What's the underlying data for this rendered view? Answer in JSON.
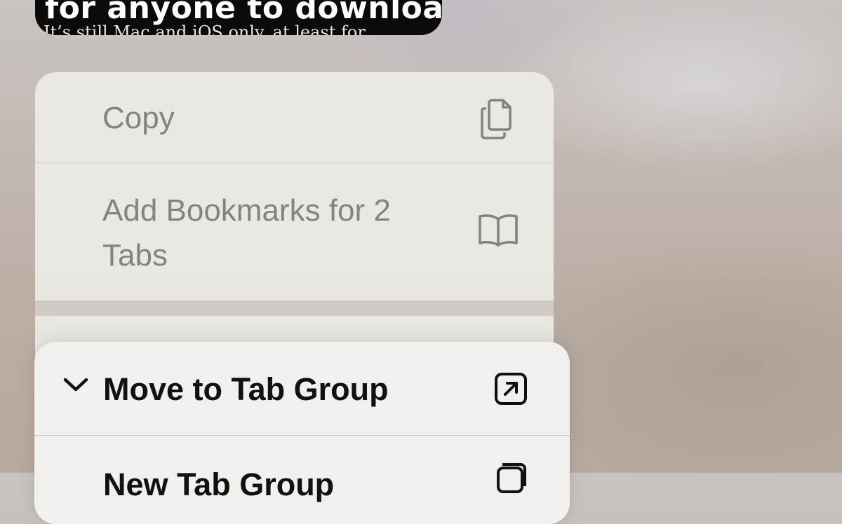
{
  "article_preview": {
    "headline": "for anyone to download",
    "subtitle": "It’s still Mac and iOS only, at least for"
  },
  "context_menu": {
    "items": [
      {
        "label": "Copy",
        "icon": "copy-icon"
      },
      {
        "label": "Add Bookmarks for 2 Tabs",
        "icon": "book-icon"
      }
    ]
  },
  "submenu": {
    "title": "Move to Tab Group",
    "title_icon": "arrow-up-right-square-icon",
    "items": [
      {
        "label": "New Tab Group",
        "icon": "new-tab-group-icon"
      }
    ]
  }
}
